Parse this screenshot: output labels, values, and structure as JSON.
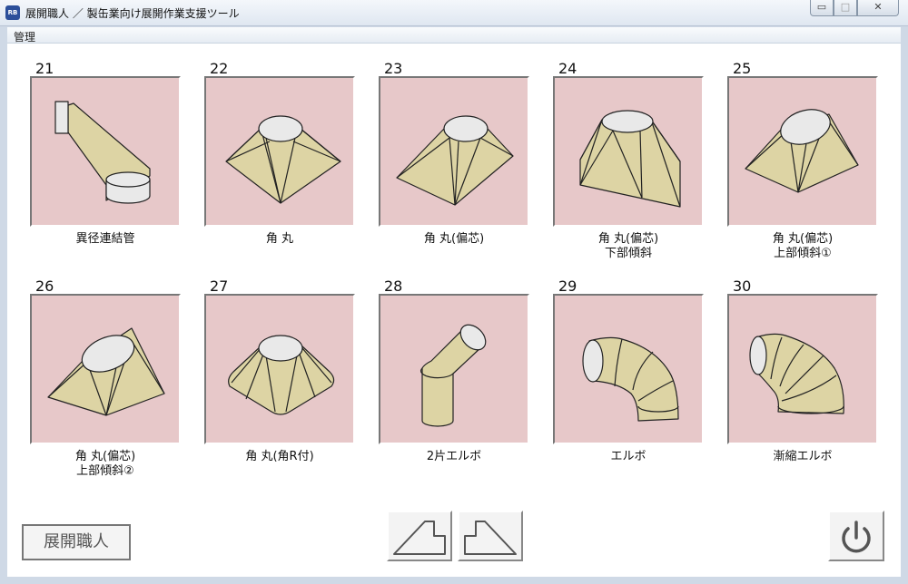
{
  "window": {
    "title": "展開職人 ／ 製缶業向け展開作業支援ツール",
    "icon_text": "RB",
    "min_glyph": "▭",
    "max_glyph": "□",
    "close_glyph": "✕"
  },
  "menu": {
    "items": [
      "管理"
    ]
  },
  "tiles": [
    {
      "number": "21",
      "label": "異径連結管",
      "icon": "offset-connecting-duct-icon"
    },
    {
      "number": "22",
      "label": "角 丸",
      "icon": "square-to-round-icon"
    },
    {
      "number": "23",
      "label": "角 丸(偏芯)",
      "icon": "square-to-round-eccentric-icon"
    },
    {
      "number": "24",
      "label": "角 丸(偏芯)\n下部傾斜",
      "icon": "square-to-round-eccentric-bottom-slope-icon"
    },
    {
      "number": "25",
      "label": "角 丸(偏芯)\n上部傾斜①",
      "icon": "square-to-round-eccentric-top-slope-1-icon"
    },
    {
      "number": "26",
      "label": "角 丸(偏芯)\n上部傾斜②",
      "icon": "square-to-round-eccentric-top-slope-2-icon"
    },
    {
      "number": "27",
      "label": "角 丸(角R付)",
      "icon": "square-to-round-rounded-corner-icon"
    },
    {
      "number": "28",
      "label": "2片エルボ",
      "icon": "two-piece-elbow-icon"
    },
    {
      "number": "29",
      "label": "エルボ",
      "icon": "elbow-icon"
    },
    {
      "number": "30",
      "label": "漸縮エルボ",
      "icon": "reducing-elbow-icon"
    }
  ],
  "footer": {
    "logo_label": "展開職人",
    "prev_icon": "previous-page-icon",
    "next_icon": "next-page-icon",
    "power_icon": "power-icon"
  },
  "colors": {
    "tile_background": "#e7c8c9",
    "shape_fill": "#ddd4a4",
    "ellipse_fill": "#e9e9e9"
  }
}
